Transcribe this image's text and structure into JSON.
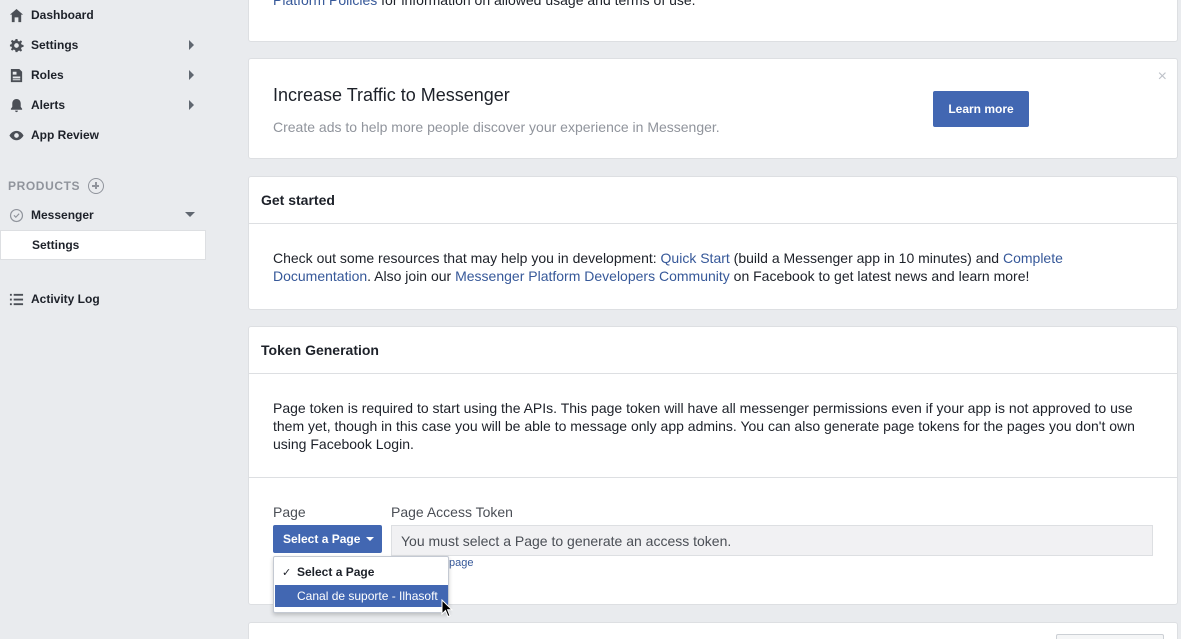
{
  "sidebar": {
    "items": [
      {
        "label": "Dashboard",
        "icon": "home-icon"
      },
      {
        "label": "Settings",
        "icon": "gear-icon"
      },
      {
        "label": "Roles",
        "icon": "roles-icon"
      },
      {
        "label": "Alerts",
        "icon": "bell-icon"
      },
      {
        "label": "App Review",
        "icon": "eye-icon"
      }
    ],
    "products_label": "PRODUCTS",
    "messenger_label": "Messenger",
    "messenger_sub_settings": "Settings",
    "activity_log": "Activity Log"
  },
  "top_card": {
    "link": "Platform Policies",
    "text": " for information on allowed usage and terms of use."
  },
  "promo": {
    "title": "Increase Traffic to Messenger",
    "subtitle": "Create ads to help more people discover your experience in Messenger.",
    "button": "Learn more",
    "close": "×"
  },
  "get_started": {
    "heading": "Get started",
    "t1": "Check out some resources that may help you in development: ",
    "link_quick": "Quick Start",
    "t2": " (build a Messenger app in 10 minutes) and ",
    "link_docs": "Complete Documentation",
    "t3": ". Also join our ",
    "link_community": "Messenger Platform Developers Community",
    "t4": " on Facebook to get latest news and learn more!"
  },
  "token": {
    "heading": "Token Generation",
    "description": "Page token is required to start using the APIs. This page token will have all messenger permissions even if your app is not approved to use them yet, though in this case you will be able to message only app admins. You can also generate page tokens for the pages you don't own using Facebook Login.",
    "page_label": "Page",
    "token_label": "Page Access Token",
    "select_button": "Select a Page",
    "token_placeholder": "You must select a Page to generate an access token.",
    "small_link": "page"
  },
  "dropdown": {
    "options": [
      "Select a Page",
      "Canal de suporte - Ilhasoft"
    ],
    "selected_index": 0,
    "highlighted_index": 1
  },
  "colors": {
    "accent": "#4267b2",
    "link": "#365899",
    "background": "#e9ebee"
  }
}
